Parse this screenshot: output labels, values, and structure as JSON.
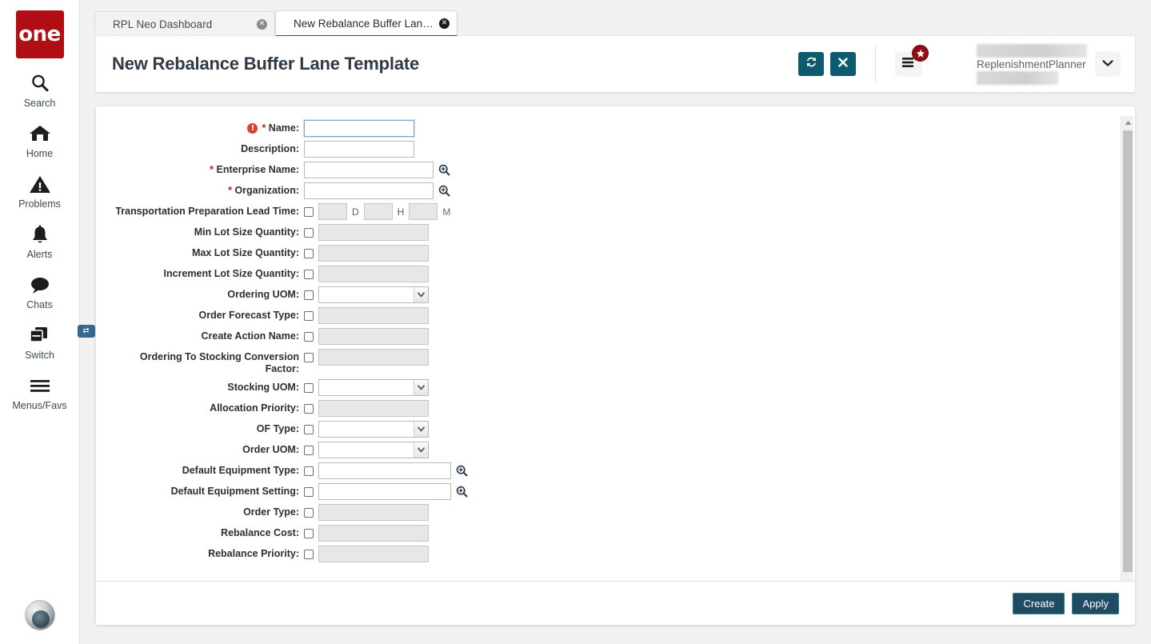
{
  "brand": {
    "logo_text": "one",
    "logo_color": "#b00d14"
  },
  "theme": {
    "teal": "#0d5c6e",
    "accent_blue": "#36688d",
    "badge_red": "#8f0d13",
    "footer_btn": "#1f4b63"
  },
  "sidebar": {
    "items": [
      {
        "label": "Search",
        "icon": "search-icon"
      },
      {
        "label": "Home",
        "icon": "home-icon"
      },
      {
        "label": "Problems",
        "icon": "warning-triangle-icon"
      },
      {
        "label": "Alerts",
        "icon": "bell-icon"
      },
      {
        "label": "Chats",
        "icon": "chat-bubble-icon"
      },
      {
        "label": "Switch",
        "icon": "switch-windows-icon",
        "badge": "⇄"
      },
      {
        "label": "Menus/Favs",
        "icon": "hamburger-icon"
      }
    ]
  },
  "tabs": [
    {
      "label": "RPL Neo Dashboard",
      "active": false
    },
    {
      "label": "New Rebalance Buffer Lane Tem...",
      "active": true
    }
  ],
  "header": {
    "title": "New Rebalance Buffer Lane Template",
    "refresh_icon": "refresh-icon",
    "close_icon": "close-icon",
    "menu_icon": "list-menu-icon",
    "menu_badge_icon": "star-icon",
    "user_name": "ReplenishmentPlanner",
    "user_caret_icon": "chevron-down-icon"
  },
  "form": {
    "rows": [
      {
        "label": "Name",
        "required": true,
        "error": true,
        "type": "text",
        "value": "",
        "width": "w-name",
        "focused": true,
        "checkbox": false
      },
      {
        "label": "Description",
        "required": false,
        "error": false,
        "type": "text",
        "value": "",
        "width": "w-desc",
        "checkbox": false
      },
      {
        "label": "Enterprise Name",
        "required": true,
        "error": false,
        "type": "lookup",
        "value": "",
        "width": "w-lookup",
        "checkbox": false,
        "lookup_icon": "magnifier-plus-icon"
      },
      {
        "label": "Organization",
        "required": true,
        "error": false,
        "type": "lookup",
        "value": "",
        "width": "w-lookup",
        "checkbox": false,
        "lookup_icon": "magnifier-plus-icon"
      },
      {
        "label": "Transportation Preparation Lead Time",
        "required": false,
        "type": "duration",
        "checkbox": true,
        "units": [
          "D",
          "H",
          "M"
        ],
        "values": [
          "",
          "",
          ""
        ]
      },
      {
        "label": "Min Lot Size Quantity",
        "type": "text",
        "value": "",
        "width": "w-std",
        "checkbox": true,
        "disabled": true
      },
      {
        "label": "Max Lot Size Quantity",
        "type": "text",
        "value": "",
        "width": "w-std",
        "checkbox": true,
        "disabled": true
      },
      {
        "label": "Increment Lot Size Quantity",
        "type": "text",
        "value": "",
        "width": "w-std",
        "checkbox": true,
        "disabled": true
      },
      {
        "label": "Ordering UOM",
        "type": "select",
        "value": "",
        "width": "w-std",
        "checkbox": true
      },
      {
        "label": "Order Forecast Type",
        "type": "text",
        "value": "",
        "width": "w-std",
        "checkbox": true,
        "disabled": true
      },
      {
        "label": "Create Action Name",
        "type": "text",
        "value": "",
        "width": "w-std",
        "checkbox": true,
        "disabled": true
      },
      {
        "label": "Ordering To Stocking Conversion Factor",
        "type": "text",
        "value": "",
        "width": "w-std",
        "checkbox": true,
        "disabled": true
      },
      {
        "label": "Stocking UOM",
        "type": "select",
        "value": "",
        "width": "w-std",
        "checkbox": true
      },
      {
        "label": "Allocation Priority",
        "type": "text",
        "value": "",
        "width": "w-std",
        "checkbox": true,
        "disabled": true
      },
      {
        "label": "OF Type",
        "type": "select",
        "value": "",
        "width": "w-std",
        "checkbox": true
      },
      {
        "label": "Order UOM",
        "type": "select",
        "value": "",
        "width": "w-std",
        "checkbox": true
      },
      {
        "label": "Default Equipment Type",
        "type": "lookup",
        "value": "",
        "width": "w-eq",
        "checkbox": true,
        "lookup_icon": "magnifier-plus-icon"
      },
      {
        "label": "Default Equipment Setting",
        "type": "lookup",
        "value": "",
        "width": "w-eq",
        "checkbox": true,
        "lookup_icon": "magnifier-plus-icon"
      },
      {
        "label": "Order Type",
        "type": "text",
        "value": "",
        "width": "w-std",
        "checkbox": true,
        "disabled": true
      },
      {
        "label": "Rebalance Cost",
        "type": "text",
        "value": "",
        "width": "w-std",
        "checkbox": true,
        "disabled": true
      },
      {
        "label": "Rebalance Priority",
        "type": "text",
        "value": "",
        "width": "w-std",
        "checkbox": true,
        "disabled": true
      }
    ]
  },
  "footer": {
    "create_label": "Create",
    "apply_label": "Apply"
  },
  "scrollbar": {
    "up_icon": "caret-up-icon",
    "down_icon": "caret-down-icon"
  }
}
